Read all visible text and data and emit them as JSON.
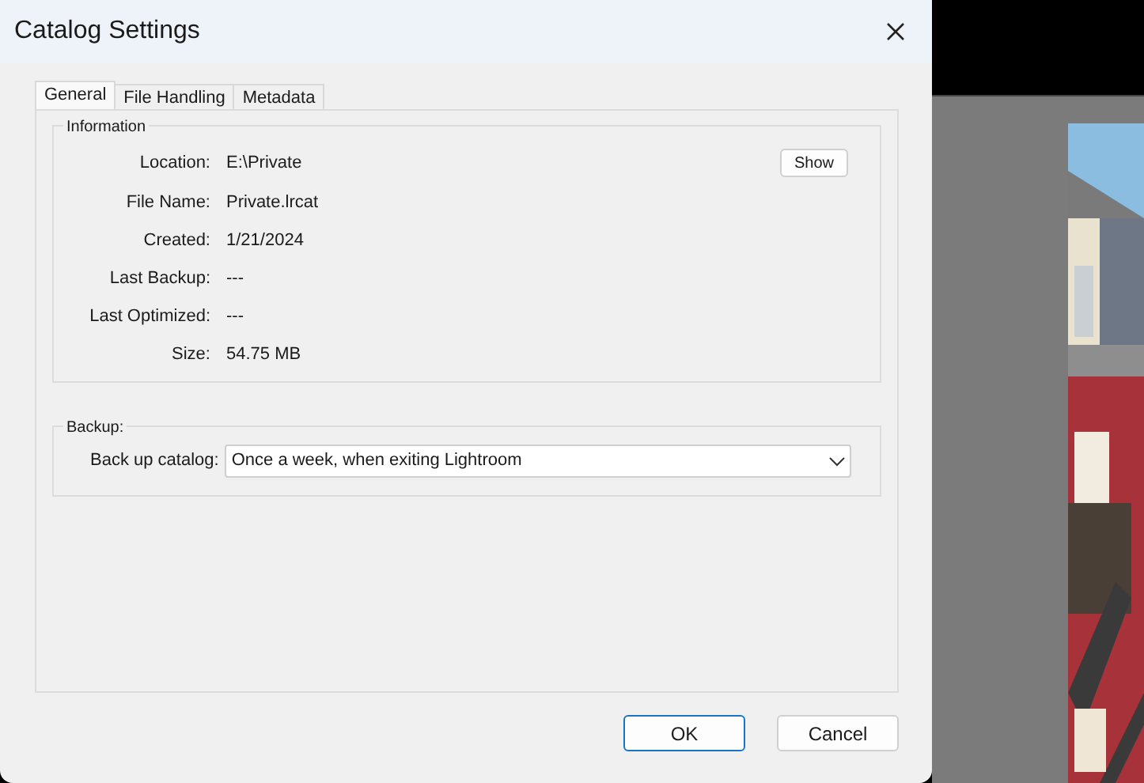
{
  "window": {
    "title": "Catalog Settings"
  },
  "tabs": [
    {
      "label": "General",
      "selected": true
    },
    {
      "label": "File Handling",
      "selected": false
    },
    {
      "label": "Metadata",
      "selected": false
    }
  ],
  "information": {
    "title": "Information",
    "fields": [
      {
        "label": "Location:",
        "value": "E:\\Private"
      },
      {
        "label": "File Name:",
        "value": "Private.lrcat"
      },
      {
        "label": "Created:",
        "value": "1/21/2024"
      },
      {
        "label": "Last Backup:",
        "value": "---"
      },
      {
        "label": "Last Optimized:",
        "value": "---"
      },
      {
        "label": "Size:",
        "value": "54.75 MB"
      }
    ],
    "show_button": "Show"
  },
  "backup": {
    "title": "Backup:",
    "label": "Back up catalog:",
    "value": "Once a week, when exiting Lightroom"
  },
  "buttons": [
    {
      "label": "OK",
      "default": true
    },
    {
      "label": "Cancel",
      "default": false
    }
  ]
}
